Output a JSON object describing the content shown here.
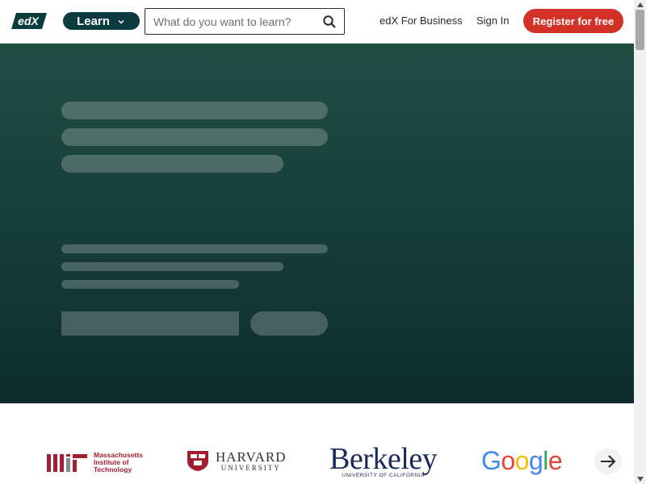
{
  "header": {
    "logo_text": "edX",
    "learn_label": "Learn",
    "search": {
      "placeholder": "What do you want to learn?",
      "value": ""
    },
    "nav": {
      "business": "edX For Business",
      "signin": "Sign In"
    },
    "register_label": "Register for free"
  },
  "colors": {
    "brand_teal": "#0b3b3f",
    "register_red": "#d23228",
    "hero_top": "#214c43",
    "hero_bottom": "#0c2c2d"
  },
  "partners": {
    "mit": {
      "line1": "Massachusetts",
      "line2": "Institute of",
      "line3": "Technology",
      "mark": "MIT"
    },
    "harvard": {
      "line1": "HARVARD",
      "line2": "UNIVERSITY"
    },
    "berkeley": {
      "line1": "Berkeley",
      "line2": "UNIVERSITY OF CALIFORNIA"
    },
    "google": {
      "letters": [
        "G",
        "o",
        "o",
        "g",
        "l",
        "e"
      ],
      "colors": [
        "#4285F4",
        "#EA4335",
        "#FBBC05",
        "#4285F4",
        "#34A853",
        "#EA4335"
      ]
    },
    "next_icon": "arrow-right-icon"
  }
}
